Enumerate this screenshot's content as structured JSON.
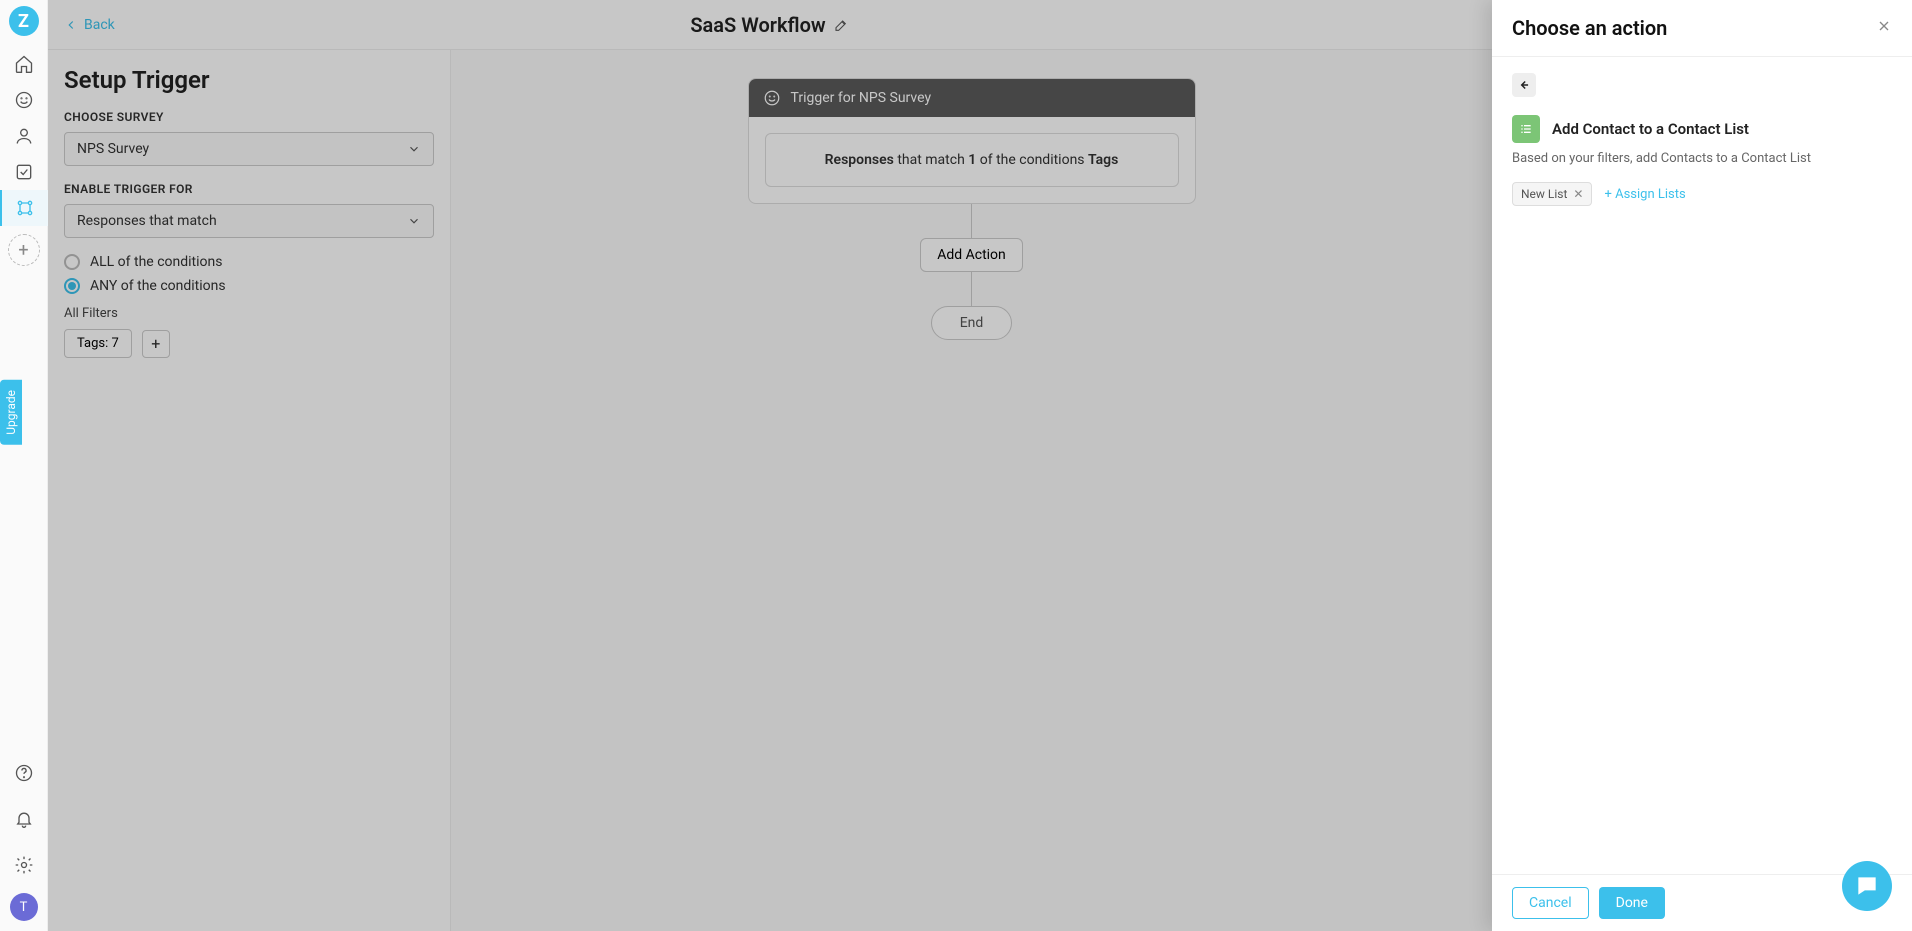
{
  "header": {
    "back_label": "Back",
    "workflow_title": "SaaS Workflow"
  },
  "rail": {
    "upgrade_label": "Upgrade",
    "avatar_initial": "T"
  },
  "setup": {
    "title": "Setup Trigger",
    "choose_survey_label": "CHOOSE SURVEY",
    "survey_selected": "NPS Survey",
    "enable_trigger_label": "ENABLE TRIGGER FOR",
    "enable_trigger_value": "Responses that match",
    "radio_all_label": "ALL of the conditions",
    "radio_any_label": "ANY of the conditions",
    "all_filters_label": "All Filters",
    "filter_chip": "Tags: 7"
  },
  "canvas": {
    "trigger_title": "Trigger for NPS Survey",
    "trigger_summary_prefix": "Responses",
    "trigger_summary_mid1": " that match ",
    "trigger_summary_count": "1",
    "trigger_summary_mid2": " of the conditions ",
    "trigger_summary_suffix": "Tags",
    "add_action_label": "Add Action",
    "end_label": "End"
  },
  "drawer": {
    "title": "Choose an action",
    "action_name": "Add Contact to a Contact List",
    "action_desc": "Based on your filters, add Contacts to a Contact List",
    "chip_label": "New List",
    "assign_link": "+ Assign Lists",
    "cancel_label": "Cancel",
    "done_label": "Done"
  }
}
